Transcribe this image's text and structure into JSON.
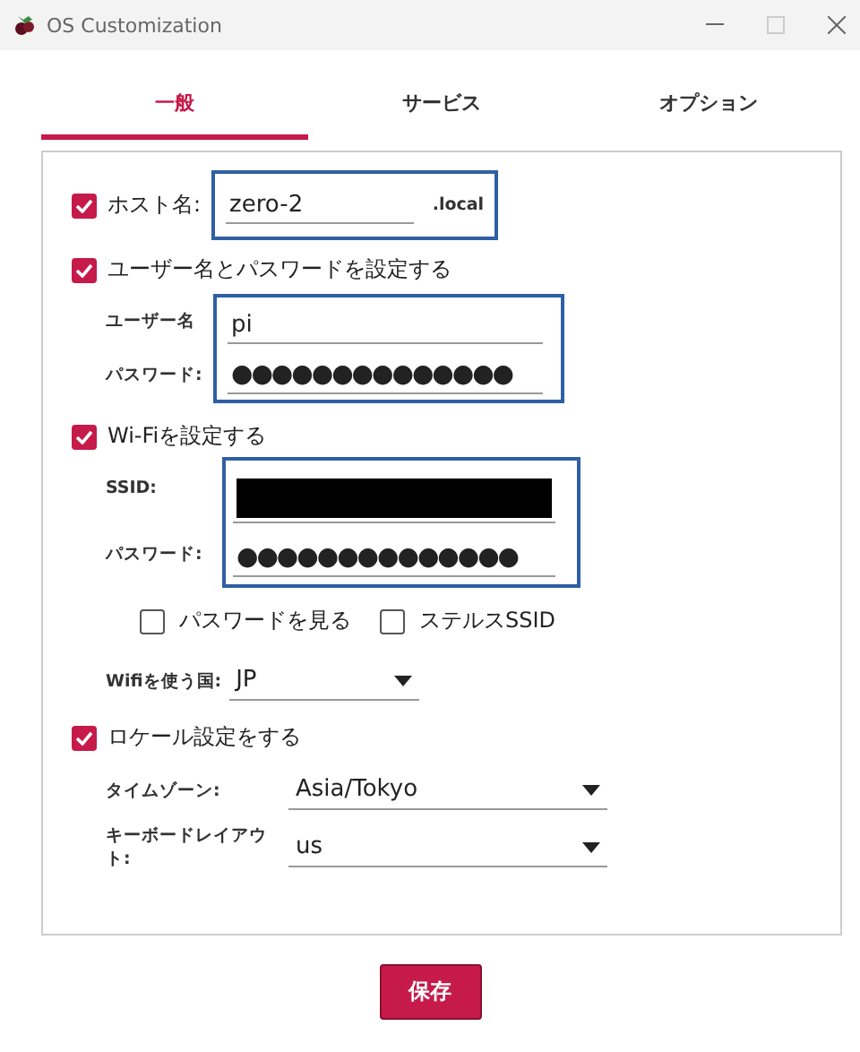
{
  "window": {
    "title": "OS Customization"
  },
  "tabs": [
    {
      "label": "一般",
      "selected": true
    },
    {
      "label": "サービス",
      "selected": false
    },
    {
      "label": "オプション",
      "selected": false
    }
  ],
  "hostname": {
    "checked": true,
    "label": "ホスト名:",
    "value": "zero-2",
    "suffix": ".local"
  },
  "user": {
    "checked": true,
    "label": "ユーザー名とパスワードを設定する",
    "username_label": "ユーザー名",
    "username": "pi",
    "password_label": "パスワード:",
    "password": "●●●●●●●●●●●●●●"
  },
  "wifi": {
    "checked": true,
    "label": "Wi-Fiを設定する",
    "ssid_label": "SSID:",
    "password_label": "パスワード:",
    "password": "●●●●●●●●●●●●●●",
    "options": [
      {
        "label": "パスワードを見る",
        "checked": false
      },
      {
        "label": "ステルスSSID",
        "checked": false
      }
    ],
    "country_label": "Wifiを使う国:",
    "country": "JP"
  },
  "locale": {
    "checked": true,
    "label": "ロケール設定をする",
    "timezone_label": "タイムゾーン:",
    "timezone": "Asia/Tokyo",
    "keyboard_label": "キーボードレイアウト:",
    "keyboard": "us"
  },
  "save_button": "保存"
}
